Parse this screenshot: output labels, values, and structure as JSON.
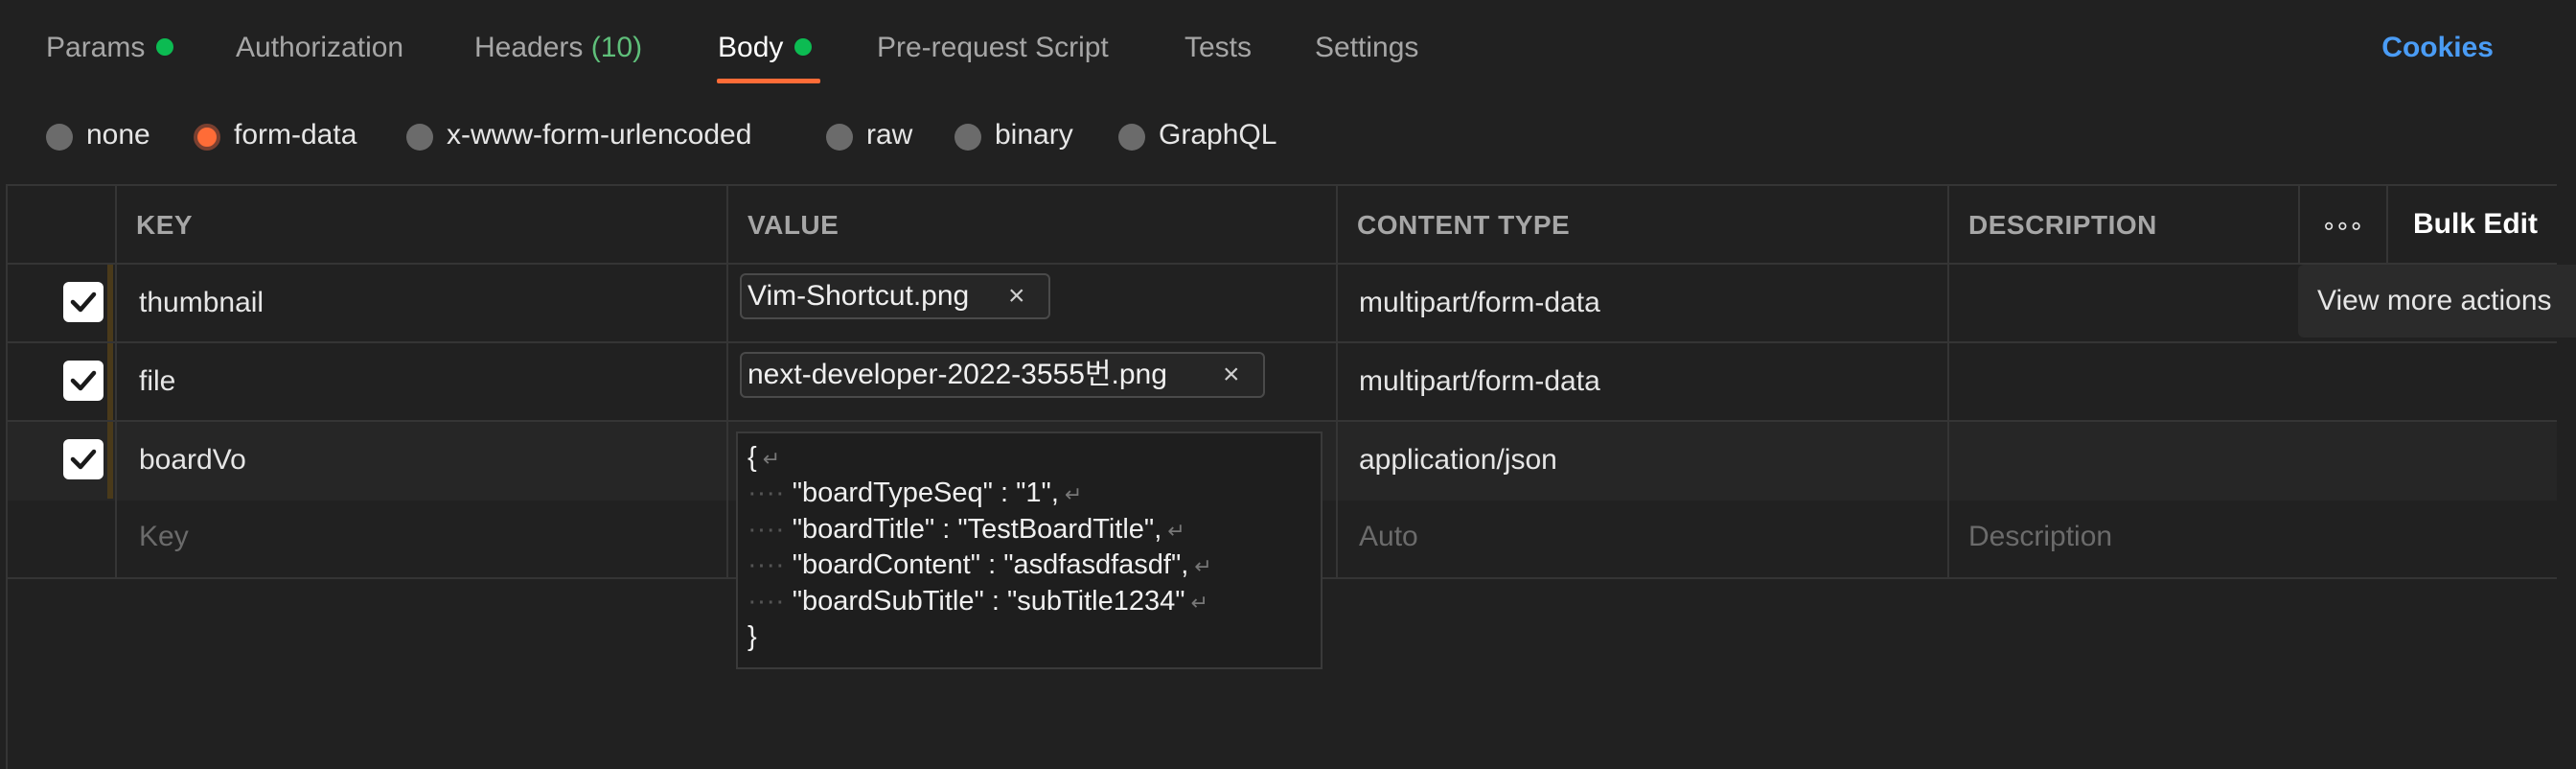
{
  "tabs": {
    "params": "Params",
    "authorization": "Authorization",
    "headers": "Headers",
    "headers_count": "(10)",
    "body": "Body",
    "pre_request": "Pre-request Script",
    "tests": "Tests",
    "settings": "Settings",
    "cookies": "Cookies"
  },
  "body_types": {
    "none": "none",
    "form_data": "form-data",
    "urlencoded": "x-www-form-urlencoded",
    "raw": "raw",
    "binary": "binary",
    "graphql": "GraphQL",
    "selected": "form-data"
  },
  "table": {
    "headers": {
      "key": "KEY",
      "value": "VALUE",
      "content_type": "CONTENT TYPE",
      "description": "DESCRIPTION",
      "more": "∘∘∘",
      "bulk_edit": "Bulk Edit"
    },
    "rows": [
      {
        "checked": true,
        "key": "thumbnail",
        "value": "Vim-Shortcut.png",
        "content_type": "multipart/form-data",
        "description": ""
      },
      {
        "checked": true,
        "key": "file",
        "value": "next-developer-2022-3555번.png",
        "content_type": "multipart/form-data",
        "description": ""
      },
      {
        "checked": true,
        "key": "boardVo",
        "value": "{",
        "content_type": "application/json",
        "description": ""
      }
    ],
    "placeholder": {
      "key": "Key",
      "content_type": "Auto",
      "description": "Description"
    }
  },
  "json_editor": {
    "lines": [
      "{",
      "\"boardTypeSeq\" : \"1\",",
      "\"boardTitle\" : \"TestBoardTitle\",",
      "\"boardContent\" : \"asdfasdfasdf\",",
      "\"boardSubTitle\" : \"subTitle1234\"",
      "}"
    ],
    "indent_marker": "····",
    "newline_marker": "↵"
  },
  "tooltip": "View more actions",
  "colors": {
    "accent": "#ff6c37",
    "status_dot": "#0cbb52",
    "link": "#4a9cf5",
    "background": "#212121"
  },
  "icons": {
    "remove_file": "×",
    "check": "checkmark-icon"
  }
}
